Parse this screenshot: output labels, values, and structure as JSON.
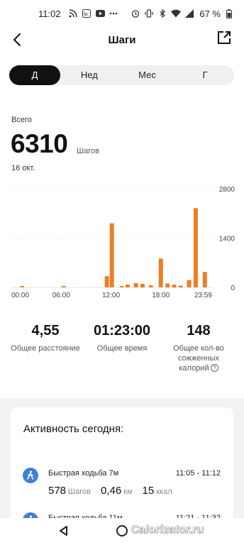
{
  "status_bar": {
    "time": "11:02",
    "battery": "67 %",
    "icons": [
      "rss-icon",
      "app-icon",
      "youtube-icon",
      "dots-icon",
      "alarm-icon",
      "vibrate-icon",
      "bluetooth-icon",
      "wifi-icon",
      "signal-icon",
      "battery-icon"
    ]
  },
  "header": {
    "title": "Шаги"
  },
  "tabs": [
    {
      "label": "Д",
      "active": true
    },
    {
      "label": "Нед",
      "active": false
    },
    {
      "label": "Мес",
      "active": false
    },
    {
      "label": "Г",
      "active": false
    }
  ],
  "summary": {
    "label": "Всего",
    "value": "6310",
    "unit": "Шагов",
    "date": "16 окт."
  },
  "chart_data": {
    "type": "bar",
    "x_tick_labels": [
      "00:00",
      "06:00",
      "12:00",
      "18:00",
      "23:59"
    ],
    "y_tick_labels": [
      "2800",
      "1400",
      "0"
    ],
    "ylim": [
      0,
      2800
    ],
    "bar_color": "#ef7d22",
    "x_hours": [
      1.3,
      6.3,
      11.5,
      12.1,
      13.3,
      14.0,
      15.0,
      15.8,
      16.8,
      18.0,
      18.8,
      19.6,
      20.4,
      21.4,
      22.2,
      23.3
    ],
    "values": [
      20,
      20,
      320,
      1820,
      35,
      80,
      120,
      100,
      60,
      820,
      110,
      80,
      50,
      210,
      2250,
      440
    ]
  },
  "stats": [
    {
      "value": "4,55",
      "label": "Общее расстояние"
    },
    {
      "value": "01:23:00",
      "label": "Общее время"
    },
    {
      "value": "148",
      "label_line1": "Общее кол-во",
      "label_line2": "сожженных",
      "label_line3": "калорий"
    }
  ],
  "activity": {
    "title": "Активность сегодня",
    "items": [
      {
        "name": "Быстрая ходьба 7м",
        "time": "11:05 - 11:12",
        "steps": "578",
        "steps_unit": "Шагов",
        "distance": "0,46",
        "distance_unit": "км",
        "calories": "15",
        "calories_unit": "ккал"
      },
      {
        "name": "Быстрая ходьба 11м",
        "time": "11:21 - 11:32"
      }
    ]
  },
  "watermark": "Calorizator.ru"
}
